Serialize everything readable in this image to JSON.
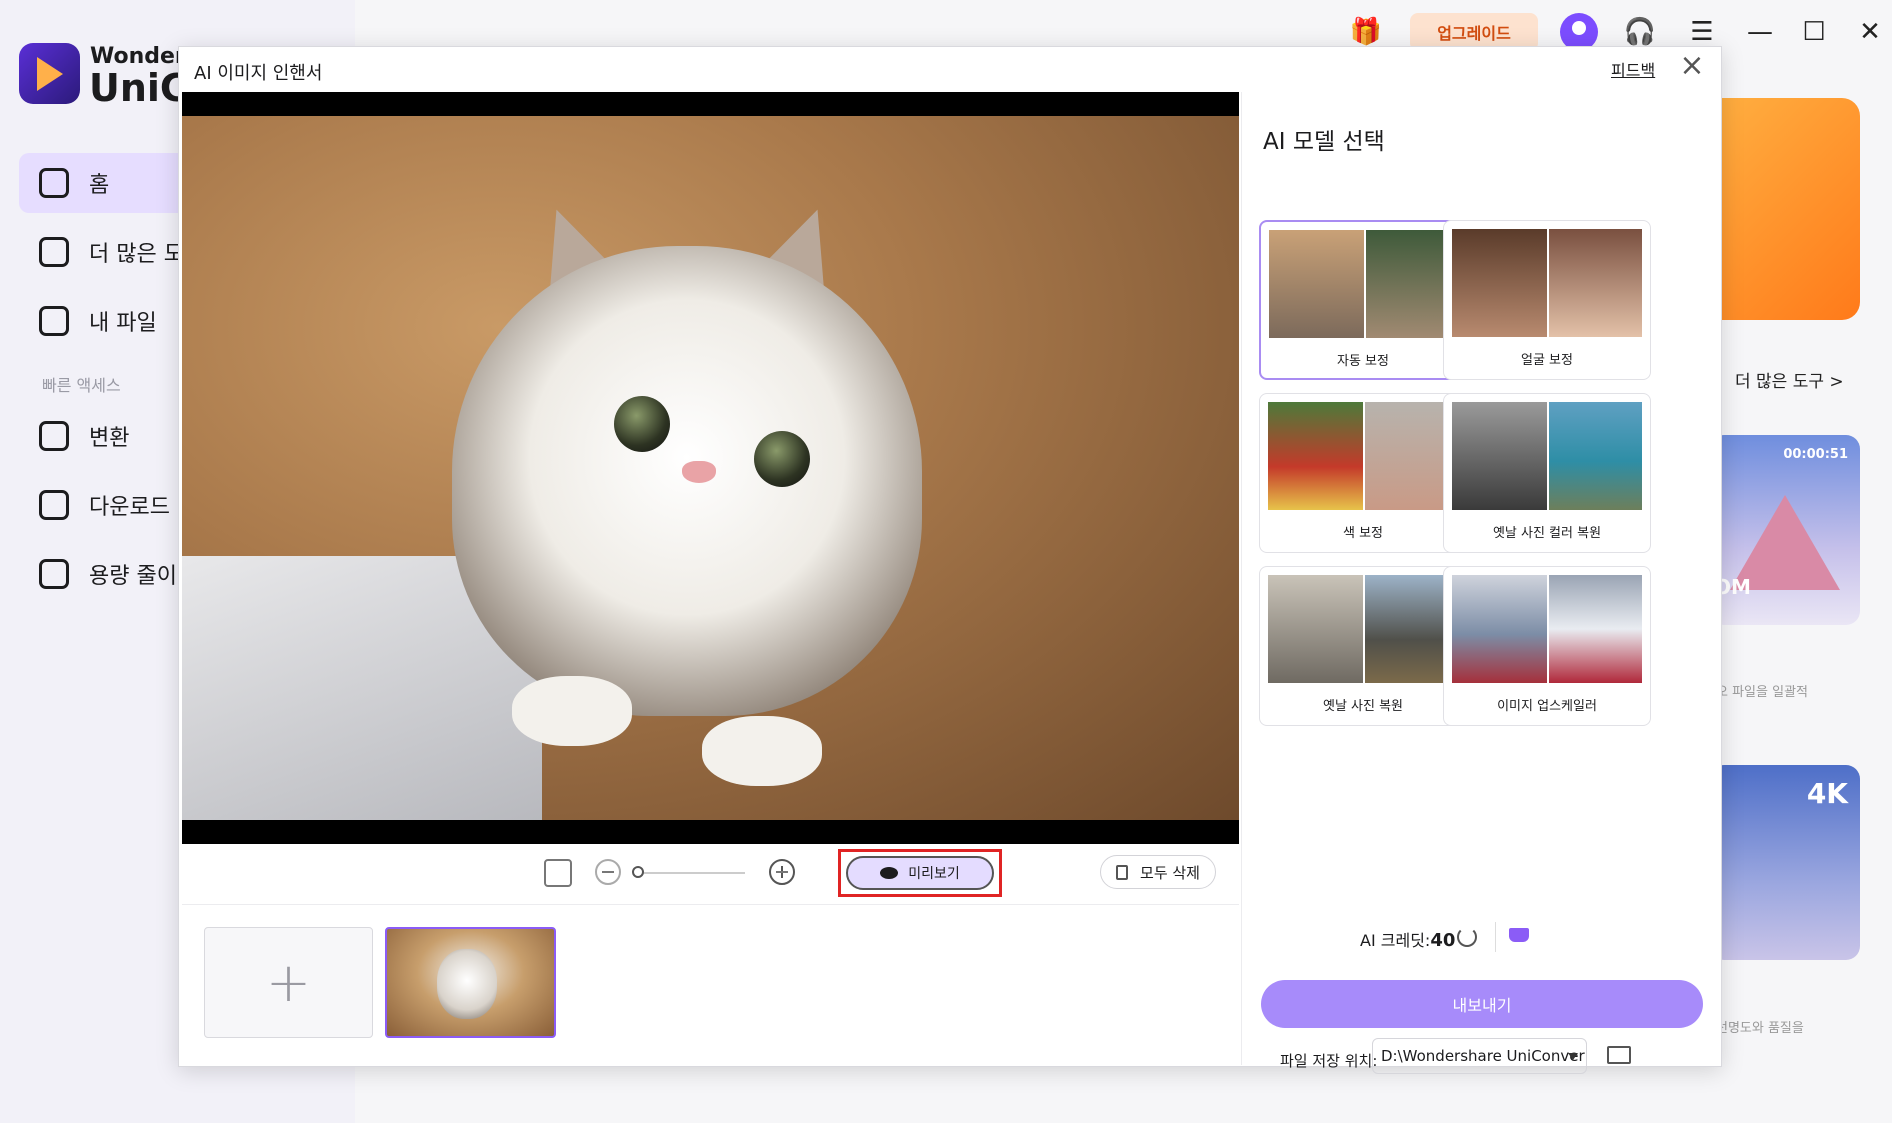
{
  "app": {
    "brand_line1": "Wonders",
    "brand_line2": "UniC",
    "nav": [
      "홈",
      "더 많은 도",
      "내 파일",
      "변환",
      "다운로드",
      "용량 줄이"
    ],
    "quick_access_label": "빠른 액세스",
    "upgrade_label": "업그레이드",
    "more_tools_label": "더 많은 도구  >",
    "card2_time": "00:00:51",
    "card2_text": "OM",
    "card2_caption": "오 파일을 일괄적",
    "card3_badge": "4K",
    "card3_caption": "선명도와 품질을"
  },
  "dialog": {
    "title": "AI 이미지 인핸서",
    "feedback": "피드백",
    "close_icon": "close-icon",
    "toolbar": {
      "preview_label": "미리보기",
      "clear_all_label": "모두 삭제"
    },
    "panel": {
      "title": "AI 모델 선택",
      "models": [
        {
          "label": "자동 보정",
          "selected": true
        },
        {
          "label": "얼굴 보정",
          "selected": false
        },
        {
          "label": "색 보정",
          "selected": false
        },
        {
          "label": "옛날 사진 컬러 복원",
          "selected": false
        },
        {
          "label": "옛날 사진 복원",
          "selected": false
        },
        {
          "label": "이미지 업스케일러",
          "selected": false
        }
      ],
      "credit_label": "AI 크레딧:",
      "credit_value": "40",
      "export_label": "내보내기",
      "save_location_label": "파일 저장 위치:",
      "save_location_value": "D:\\Wondershare UniConver"
    }
  },
  "colors": {
    "accent": "#8b5cf6",
    "export_button": "#a78bfa",
    "highlight_box": "#e02424"
  }
}
